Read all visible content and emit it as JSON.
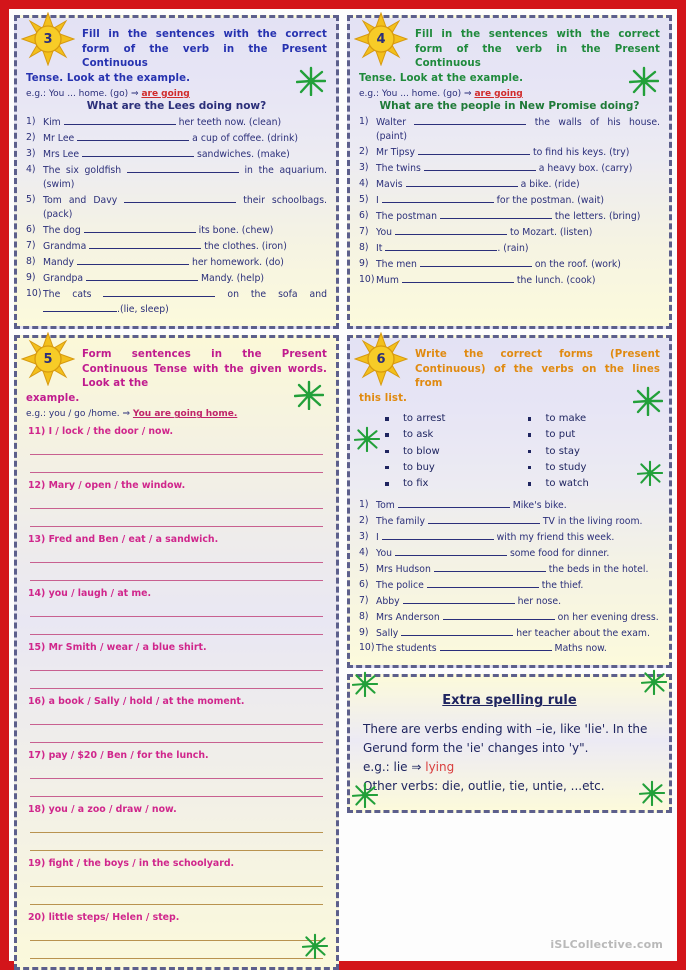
{
  "footer": {
    "watermark": "iSLCollective.com"
  },
  "colors": {
    "page_border": "#d3151a",
    "panel_border": "#5c5f8c",
    "ink_blue": "#2b2f7a",
    "heading_blue": "#2632b0",
    "heading_green": "#1f8a3c",
    "heading_pink": "#c01b8e",
    "heading_orange": "#e08a10",
    "answer_red": "#d12b2b",
    "sun_gold": "#f5c21b",
    "sparkle_green": "#22a03a"
  },
  "exercises": [
    {
      "number": "3",
      "instruction": "Fill in the sentences with the correct form of the verb in the Present Continuous",
      "instruction_tail": "Tense. Look at the example.",
      "example_prefix": "e.g.: You ... home. (go) ",
      "example_arrow": "⇒ ",
      "example_answer": "are going",
      "subheading": "What are the Lees doing now?",
      "items": [
        {
          "n": "1)",
          "before": "Kim ",
          "blank": "b-l",
          "after": " her teeth now. (clean)"
        },
        {
          "n": "2)",
          "before": "Mr Lee ",
          "blank": "b-l",
          "after": " a cup of coffee. (drink)"
        },
        {
          "n": "3)",
          "before": "Mrs Lee ",
          "blank": "b-l",
          "after": " sandwiches. (make)"
        },
        {
          "n": "4)",
          "before": "The six goldfish ",
          "blank": "b-l",
          "after": " in the aquarium. (swim)"
        },
        {
          "n": "5)",
          "before": "Tom and Davy ",
          "blank": "b-l",
          "after": " their schoolbags. (pack)"
        },
        {
          "n": "6)",
          "before": "The dog ",
          "blank": "b-l",
          "after": " its bone. (chew)"
        },
        {
          "n": "7)",
          "before": "Grandma ",
          "blank": "b-l",
          "after": " the clothes. (iron)"
        },
        {
          "n": "8)",
          "before": "Mandy ",
          "blank": "b-l",
          "after": " her homework. (do)"
        },
        {
          "n": "9)",
          "before": "Grandpa ",
          "blank": "b-l",
          "after": " Mandy. (help)"
        },
        {
          "n": "10)",
          "before": "The cats ",
          "blank": "b-l",
          "after": " on the sofa and ",
          "blank2": "b-s",
          "after2": ".(lie, sleep)"
        }
      ]
    },
    {
      "number": "4",
      "instruction": "Fill in the sentences with the correct form of the verb in the Present Continuous",
      "instruction_tail": "Tense. Look at the example.",
      "example_prefix": "e.g.: You ... home. (go) ",
      "example_arrow": "⇒ ",
      "example_answer": "are going",
      "subheading": "What are the people in New Promise doing?",
      "items": [
        {
          "n": "1)",
          "before": "Walter ",
          "blank": "b-l",
          "after": " the walls of his house. (paint)"
        },
        {
          "n": "2)",
          "before": "Mr Tipsy ",
          "blank": "b-l",
          "after": " to find his keys. (try)"
        },
        {
          "n": "3)",
          "before": "The twins ",
          "blank": "b-l",
          "after": " a heavy box. (carry)"
        },
        {
          "n": "4)",
          "before": "Mavis ",
          "blank": "b-l",
          "after": " a bike. (ride)"
        },
        {
          "n": "5)",
          "before": "I ",
          "blank": "b-l",
          "after": " for the postman. (wait)"
        },
        {
          "n": "6)",
          "before": "The postman ",
          "blank": "b-l",
          "after": " the letters. (bring)"
        },
        {
          "n": "7)",
          "before": "You ",
          "blank": "b-l",
          "after": " to Mozart. (listen)"
        },
        {
          "n": "8)",
          "before": "It ",
          "blank": "b-l",
          "after": ". (rain)"
        },
        {
          "n": "9)",
          "before": "The men ",
          "blank": "b-l",
          "after": " on the roof. (work)"
        },
        {
          "n": "10)",
          "before": "Mum ",
          "blank": "b-l",
          "after": " the lunch. (cook)"
        }
      ]
    },
    {
      "number": "5",
      "instruction": "Form sentences in the Present Continuous Tense with the given words. Look at the",
      "instruction_tail": "example.",
      "example_prefix": "e.g.: you / go /home. ",
      "example_arrow": "⇒ ",
      "example_answer": "You are going home.",
      "prompts": [
        "11)  I / lock / the door / now.",
        "12)  Mary / open / the window.",
        "13)  Fred and Ben / eat / a sandwich.",
        "14)  you / laugh / at me.",
        "15)  Mr Smith / wear / a blue shirt.",
        "16)  a book / Sally / hold / at the moment.",
        "17)  pay / $20 / Ben / for the lunch.",
        "18)  you / a zoo / draw / now.",
        "19)  fight / the boys / in the schoolyard.",
        "20) little steps/ Helen / step."
      ]
    },
    {
      "number": "6",
      "instruction": "Write the correct forms (Present Continuous) of the verbs on the lines from",
      "instruction_tail": "this list.",
      "verbs_left": [
        "to arrest",
        "to ask",
        "to blow",
        "to buy",
        "to fix"
      ],
      "verbs_right": [
        "to make",
        "to put",
        "to stay",
        "to study",
        "to watch"
      ],
      "items": [
        {
          "n": "1)",
          "before": "Tom ",
          "blank": "b-l",
          "after": " Mike's bike."
        },
        {
          "n": "2)",
          "before": "The family ",
          "blank": "b-l",
          "after": " TV in the living room."
        },
        {
          "n": "3)",
          "before": "I ",
          "blank": "b-l",
          "after": " with my friend this week."
        },
        {
          "n": "4)",
          "before": "You ",
          "blank": "b-l",
          "after": " some food for dinner."
        },
        {
          "n": "5)",
          "before": "Mrs Hudson ",
          "blank": "b-l",
          "after": " the beds in the hotel."
        },
        {
          "n": "6)",
          "before": "The police ",
          "blank": "b-l",
          "after": " the thief."
        },
        {
          "n": "7)",
          "before": "Abby ",
          "blank": "b-l",
          "after": " her nose."
        },
        {
          "n": "8)",
          "before": "Mrs Anderson ",
          "blank": "b-l",
          "after": " on her evening dress."
        },
        {
          "n": "9)",
          "before": "Sally ",
          "blank": "b-l",
          "after": " her teacher about the exam."
        },
        {
          "n": "10)",
          "before": "The students ",
          "blank": "b-l",
          "after": " Maths now."
        }
      ]
    }
  ],
  "extra_rule": {
    "title": "Extra spelling rule",
    "line1": "There are verbs ending with –ie, like 'lie'. In the Gerund form the 'ie' changes into 'y\".",
    "eg_prefix": "e.g.: lie ⇒ ",
    "eg_answer": "lying",
    "line2": "Other verbs: die, outlie, tie, untie, ...etc."
  }
}
